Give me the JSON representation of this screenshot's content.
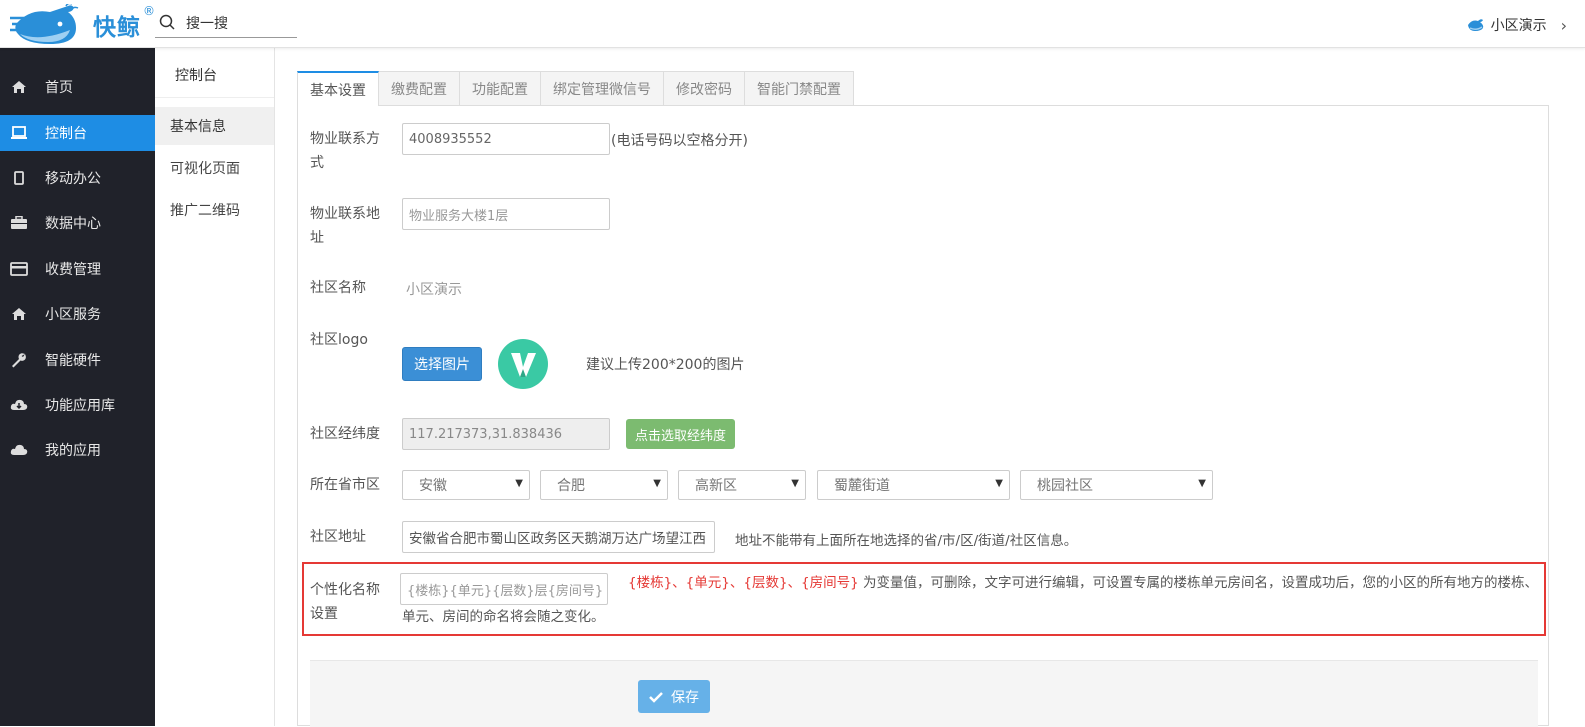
{
  "header": {
    "brand": "快鲸",
    "brand_mark": "®",
    "search_placeholder": "搜一搜",
    "user_label": "小区演示"
  },
  "sidebar": {
    "items": [
      {
        "label": "首页",
        "icon": "home-icon"
      },
      {
        "label": "控制台",
        "icon": "laptop-icon",
        "active": true
      },
      {
        "label": "移动办公",
        "icon": "mobile-icon"
      },
      {
        "label": "数据中心",
        "icon": "briefcase-icon"
      },
      {
        "label": "收费管理",
        "icon": "credit-card-icon"
      },
      {
        "label": "小区服务",
        "icon": "home-icon"
      },
      {
        "label": "智能硬件",
        "icon": "wrench-icon"
      },
      {
        "label": "功能应用库",
        "icon": "cloud-download-icon"
      },
      {
        "label": "我的应用",
        "icon": "cloud-icon"
      }
    ]
  },
  "subnav": {
    "title": "控制台",
    "items": [
      {
        "label": "基本信息",
        "active": true
      },
      {
        "label": "可视化页面"
      },
      {
        "label": "推广二维码"
      }
    ]
  },
  "tabs": [
    "基本设置",
    "缴费配置",
    "功能配置",
    "绑定管理微信号",
    "修改密码",
    "智能门禁配置"
  ],
  "form": {
    "phone": {
      "label": "物业联系方式",
      "value": "4008935552",
      "hint": "(电话号码以空格分开)"
    },
    "address": {
      "label": "物业联系地址",
      "placeholder": "物业服务大楼1层"
    },
    "community_name": {
      "label": "社区名称",
      "value": "小区演示"
    },
    "logo": {
      "label": "社区logo",
      "button": "选择图片",
      "hint": "建议上传200*200的图片"
    },
    "coords": {
      "label": "社区经纬度",
      "value": "117.217373,31.838436",
      "button": "点击选取经纬度"
    },
    "region": {
      "label": "所在省市区",
      "province": "安徽",
      "city": "合肥",
      "district": "高新区",
      "street": "蜀麓街道",
      "community": "桃园社区"
    },
    "community_address": {
      "label": "社区地址",
      "value": "安徽省合肥市蜀山区政务区天鹅湖万达广场望江西",
      "hint": "地址不能带有上面所在地选择的省/市/区/街道/社区信息。"
    },
    "custom_naming": {
      "label": "个性化名称设置",
      "placeholder": "{楼栋}{单元}{层数}层{房间号}",
      "vars": "{楼栋}、{单元}、{层数}、{房间号}",
      "desc": " 为变量值，可删除，文字可进行编辑，可设置专属的楼栋单元房间名，设置成功后，您的小区的所有地方的楼栋、单元、房间的命名将会随之变化。"
    },
    "save_label": "保存"
  },
  "colors": {
    "nav_bg": "#20222a",
    "accent": "#1e8de4",
    "highlight_border": "#e53935",
    "green_button": "#7cbb70"
  }
}
